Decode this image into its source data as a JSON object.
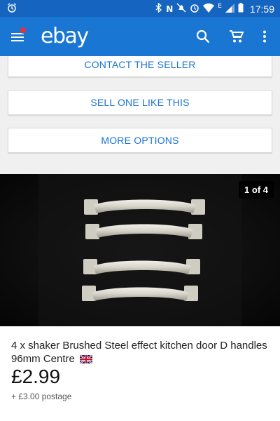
{
  "status_bar": {
    "time": "17:59",
    "network": "E"
  },
  "app_bar": {
    "logo": "ebay",
    "icons": [
      "menu-icon",
      "search-icon",
      "cart-icon",
      "more-vert-icon"
    ]
  },
  "actions": {
    "contact_seller": "CONTACT THE SELLER",
    "sell_one_like_this": "SELL ONE LIKE THIS",
    "more_options": "MORE OPTIONS"
  },
  "gallery": {
    "counter": "1 of 4"
  },
  "listing": {
    "title": "4 x shaker Brushed Steel effect kitchen door D handles 96mm Centre",
    "flag": "uk-flag-icon",
    "price": "£2.99",
    "postage": "+ £3.00 postage"
  },
  "colors": {
    "status_bar": "#1565c0",
    "app_bar": "#1976d2",
    "link_blue": "#1a73d4",
    "notification_dot": "#e53238"
  }
}
